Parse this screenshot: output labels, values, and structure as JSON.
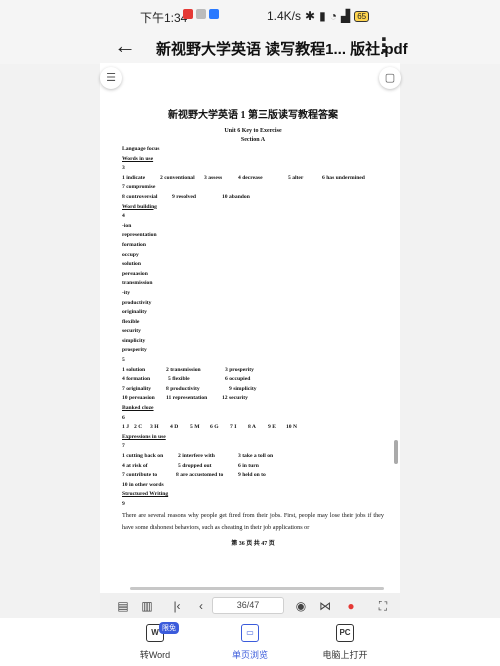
{
  "status": {
    "time": "下午1:34",
    "speed": "1.4K/s",
    "battery": "65"
  },
  "titlebar": {
    "back_symbol": "←",
    "title": "新视野大学英语 读写教程1...  版社.pdf",
    "more_symbol": "⋮"
  },
  "doc": {
    "title": "新视野大学英语 1 第三版读写教程答案",
    "unit": "Unit 6 Key to Exercise",
    "section": "Section A",
    "lines": [
      {
        "t": "Language focus",
        "s": "b"
      },
      {
        "t": "Words in use",
        "s": "u"
      },
      {
        "t": "3",
        "s": "b"
      },
      {
        "row": [
          "1 indicate",
          "2 conventional",
          "3 assess",
          "4 decrease",
          "5 alter",
          "6 has undermined"
        ],
        "w": [
          38,
          44,
          34,
          50,
          34,
          60
        ]
      },
      {
        "t": "7 compromise",
        "s": "b"
      },
      {
        "row": [
          "8 controversial",
          "9 resolved",
          "10 abandon"
        ],
        "w": [
          50,
          50,
          60
        ]
      },
      {
        "t": "Word building",
        "s": "u"
      },
      {
        "t": "4",
        "s": "b"
      },
      {
        "t": "-ion",
        "s": "b"
      },
      {
        "t": "representation",
        "s": "b"
      },
      {
        "t": "formation",
        "s": "b"
      },
      {
        "t": "occupy",
        "s": "b"
      },
      {
        "t": "solution",
        "s": "b"
      },
      {
        "t": "persuasion",
        "s": "b"
      },
      {
        "t": "transmission",
        "s": "b"
      },
      {
        "t": "-ity",
        "s": "b"
      },
      {
        "t": "productivity",
        "s": "b"
      },
      {
        "t": "originality",
        "s": "b"
      },
      {
        "t": "flexible",
        "s": "b"
      },
      {
        "t": "security",
        "s": "b"
      },
      {
        "t": "simplicity",
        "s": "b"
      },
      {
        "t": "prosperity",
        "s": "b"
      },
      {
        "t": "5",
        "s": "b"
      },
      {
        "row": [
          "1 solution",
          "2 transmission",
          "3 prosperity"
        ],
        "w": [
          44,
          59,
          60
        ]
      },
      {
        "row": [
          "4 formation",
          "5 flexible",
          "6 occupied"
        ],
        "w": [
          46,
          57,
          60
        ]
      },
      {
        "row": [
          "7 originality",
          "8 productivity",
          "9 simplicity"
        ],
        "w": [
          44,
          63,
          60
        ]
      },
      {
        "row": [
          "10 persuasion",
          "11 representation",
          "12 security"
        ],
        "w": [
          44,
          56,
          60
        ]
      },
      {
        "t": "Banked cloze",
        "s": "u"
      },
      {
        "t": "6",
        "s": "b"
      },
      {
        "row": [
          "1 J",
          "2 C",
          "3 H",
          "4 D",
          "5 M",
          "6 G",
          "7 I",
          "8 A",
          "9 E",
          "10 N"
        ],
        "w": [
          12,
          16,
          20,
          20,
          20,
          20,
          18,
          20,
          18,
          20
        ]
      },
      {
        "t": "Expressions in use",
        "s": "u"
      },
      {
        "t": "7",
        "s": "b"
      },
      {
        "row": [
          "1 cutting back on",
          "2 interfere with",
          "3 take a toll on"
        ],
        "w": [
          56,
          60,
          60
        ]
      },
      {
        "row": [
          "4 at risk of",
          "5 dropped out",
          "6 in turn"
        ],
        "w": [
          56,
          60,
          60
        ]
      },
      {
        "row": [
          "7 contribute to",
          "8 are accustomed to",
          "9 held on to"
        ],
        "w": [
          54,
          62,
          60
        ]
      },
      {
        "t": "10 in other words",
        "s": "b"
      },
      {
        "t": "Structured Writing",
        "s": "u"
      },
      {
        "t": "9",
        "s": "b"
      }
    ],
    "paragraph": "There are several reasons why people get fired from their jobs. First, people may lose their jobs if they have some dishonest behaviors, such as cheating in their job applications or",
    "footer": "第 36 页 共 47 页"
  },
  "toolbar": {
    "page": "36/47"
  },
  "bottomnav": {
    "items": [
      {
        "label": "转Word",
        "badge": "限免",
        "icon": "W"
      },
      {
        "label": "单页浏览",
        "icon": "▭"
      },
      {
        "label": "电脑上打开",
        "icon": "PC"
      }
    ]
  },
  "colors": {
    "accent": "#3b5bdb",
    "red_button": "#e53935"
  }
}
